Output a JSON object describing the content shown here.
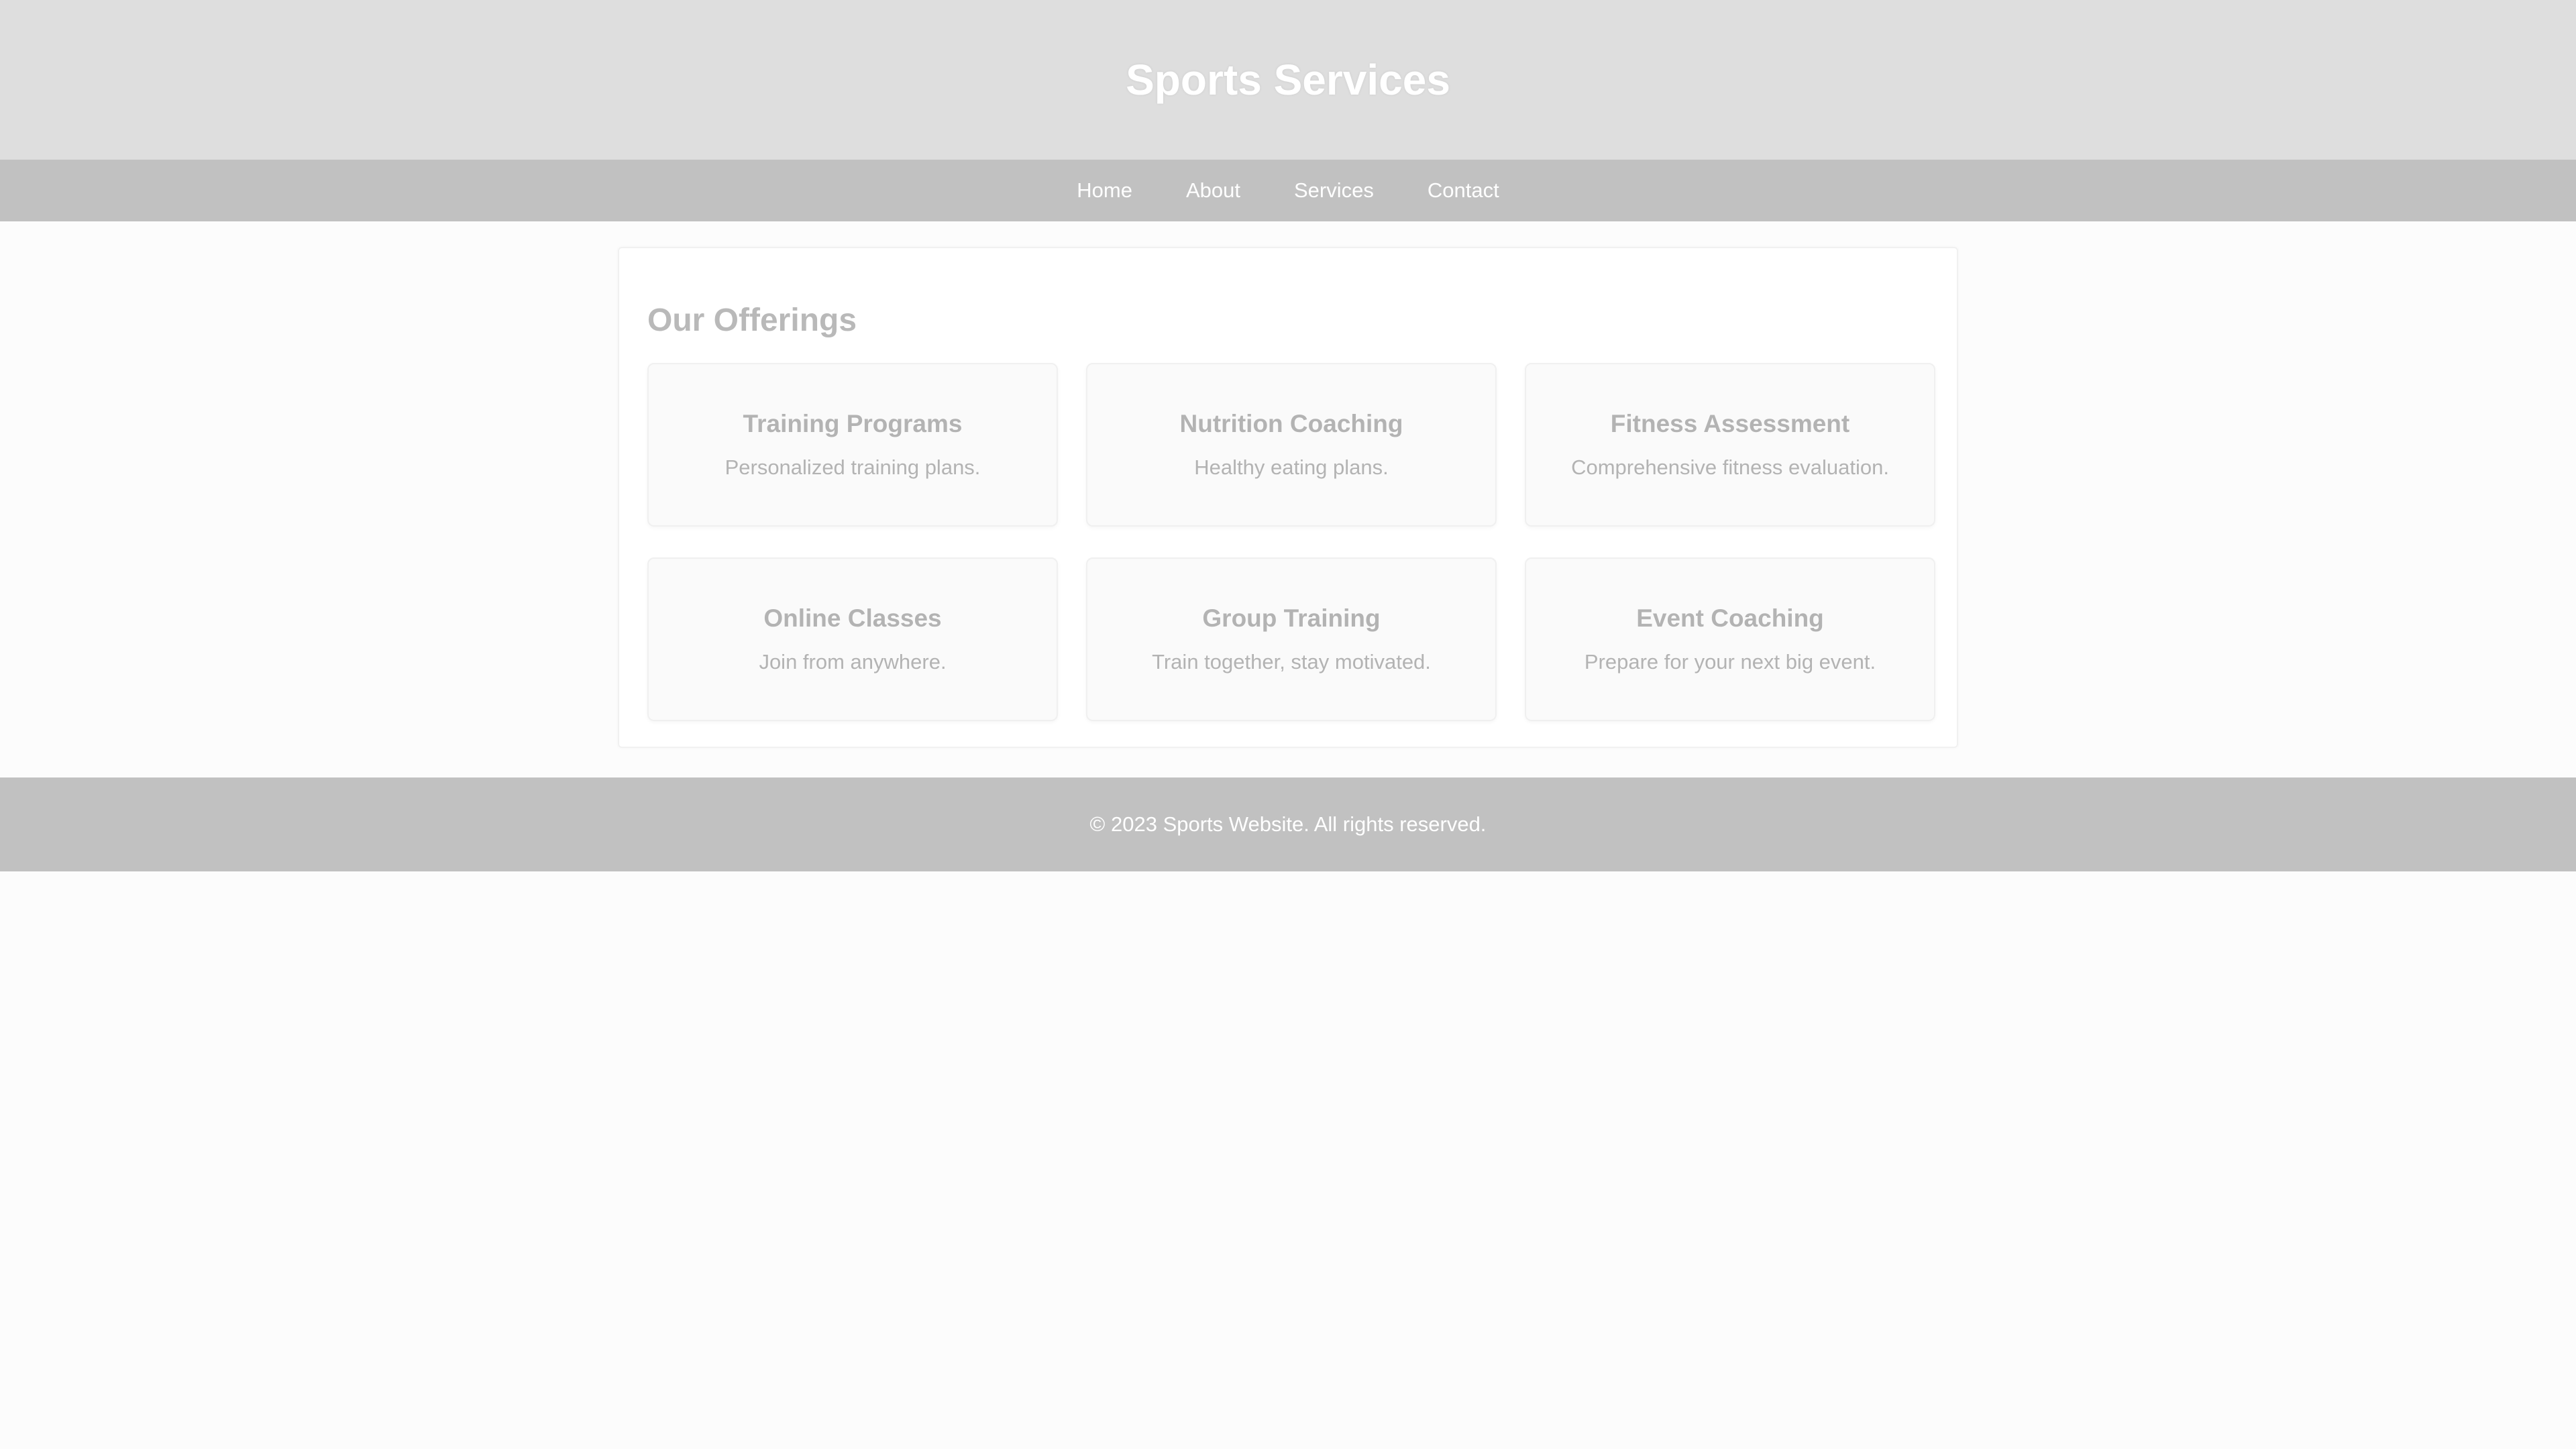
{
  "header": {
    "title": "Sports Services"
  },
  "nav": {
    "items": [
      {
        "label": "Home"
      },
      {
        "label": "About"
      },
      {
        "label": "Services"
      },
      {
        "label": "Contact"
      }
    ]
  },
  "offerings": {
    "title": "Our Offerings",
    "cards": [
      {
        "title": "Training Programs",
        "description": "Personalized training plans."
      },
      {
        "title": "Nutrition Coaching",
        "description": "Healthy eating plans."
      },
      {
        "title": "Fitness Assessment",
        "description": "Comprehensive fitness evaluation."
      },
      {
        "title": "Online Classes",
        "description": "Join from anywhere."
      },
      {
        "title": "Group Training",
        "description": "Train together, stay motivated."
      },
      {
        "title": "Event Coaching",
        "description": "Prepare for your next big event."
      }
    ]
  },
  "footer": {
    "text": "© 2023 Sports Website. All rights reserved."
  },
  "colors": {
    "header_bg": "#dedede",
    "nav_bg": "#c1c1c1",
    "footer_bg": "#c1c1c1",
    "page_bg": "#fcfcfc",
    "card_bg": "#fafafa",
    "muted_text": "#b3b3b3"
  }
}
